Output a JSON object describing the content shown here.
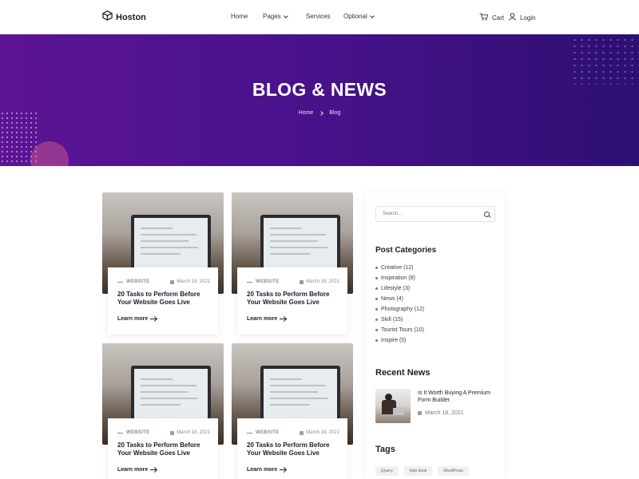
{
  "header": {
    "logo_text": "Hoston",
    "nav": [
      {
        "label": "Home",
        "has_dropdown": false
      },
      {
        "label": "Pages",
        "has_dropdown": true
      },
      {
        "label": "Services",
        "has_dropdown": false
      },
      {
        "label": "Optional",
        "has_dropdown": true
      }
    ],
    "cart_label": "Cart",
    "login_label": "Login"
  },
  "hero": {
    "title": "BLOG & NEWS",
    "breadcrumb": [
      "Home",
      "Blog"
    ]
  },
  "posts": [
    {
      "category": "WEBSITE",
      "date": "March 18, 2021",
      "title": "20 Tasks to Perform Before Your Website Goes Live",
      "cta": "Learn more"
    },
    {
      "category": "WEBSITE",
      "date": "March 18, 2021",
      "title": "20 Tasks to Perform Before Your Website Goes Live",
      "cta": "Learn more"
    },
    {
      "category": "WEBSITE",
      "date": "March 18, 2021",
      "title": "20 Tasks to Perform Before Your Website Goes Live",
      "cta": "Learn more"
    },
    {
      "category": "WEBSITE",
      "date": "March 18, 2021",
      "title": "20 Tasks to Perform Before Your Website Goes Live",
      "cta": "Learn more"
    }
  ],
  "sidebar": {
    "search_placeholder": "Search...",
    "categories_title": "Post Categories",
    "categories": [
      "Creative (12)",
      "Inspiration (8)",
      "Lifestyle (3)",
      "News (4)",
      "Photography (12)",
      "Skill (15)",
      "Tourist Tours (10)",
      "Inspire (5)"
    ],
    "recent_title": "Recent News",
    "recent": {
      "title": "Is It Worth Buying A Premium Form Builder.",
      "date": "March 18, 2021"
    },
    "tags_title": "Tags",
    "tags": [
      "jQuery",
      "help desk",
      "WordPress"
    ]
  },
  "colors": {
    "hero_start": "#5c1494",
    "hero_end": "#2d0f72"
  }
}
